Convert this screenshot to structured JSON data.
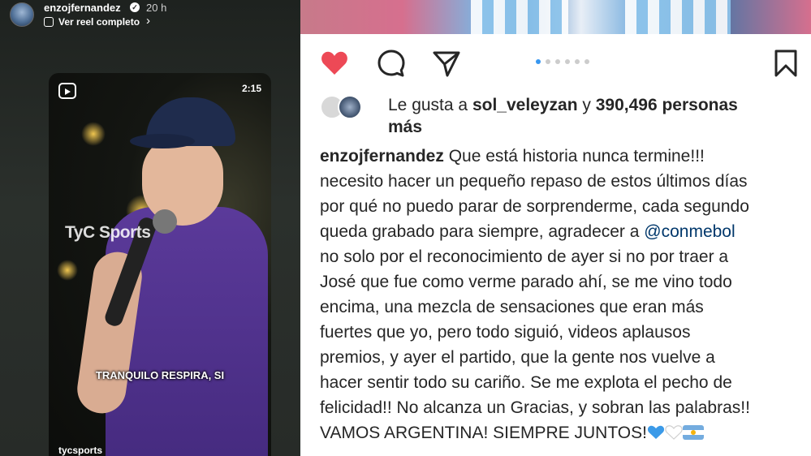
{
  "story": {
    "username": "enzojfernandez",
    "time": "20 h",
    "reel_link": "Ver reel completo",
    "video": {
      "duration": "2:15",
      "watermark": "TyC Sports",
      "subtitle": "TRANQUILO RESPIRA, SI",
      "credit": "tycsports"
    }
  },
  "post": {
    "icons": [
      "heart-icon",
      "comment-icon",
      "share-icon",
      "bookmark-icon"
    ],
    "carousel_dots": 6,
    "likes": {
      "prefix": "Le gusta a",
      "user": "sol_veleyzan",
      "connector": "y",
      "count": "390,496 personas",
      "suffix": "más"
    },
    "caption": {
      "username": "enzojfernandez",
      "first": "Que está historia nunca termine!!!",
      "l2": "necesito hacer un pequeño repaso de estos últimos días",
      "l3": "por qué no puedo parar de sorprenderme, cada segundo",
      "l4a": "queda grabado para siempre, agradecer a",
      "mention": "@conmebol",
      "l5": "no solo por el reconocimiento de ayer si no por traer a",
      "l6": "José que fue como verme parado ahí, se me vino todo",
      "l7": "encima, una mezcla de sensaciones que eran más",
      "l8": "fuertes que yo, pero todo siguió, videos aplausos",
      "l9": "premios, y ayer el partido, que la gente nos vuelve a",
      "l10": "hacer sentir todo su cariño. Se me explota el pecho de",
      "l11": "felicidad!! No alcanza un Gracias, y sobran las palabras!!",
      "l12": "VAMOS ARGENTINA! SIEMPRE JUNTOS!"
    },
    "colors": {
      "heart": "#ed4956",
      "mention": "#00376b",
      "active_dot": "#3897f0"
    }
  }
}
